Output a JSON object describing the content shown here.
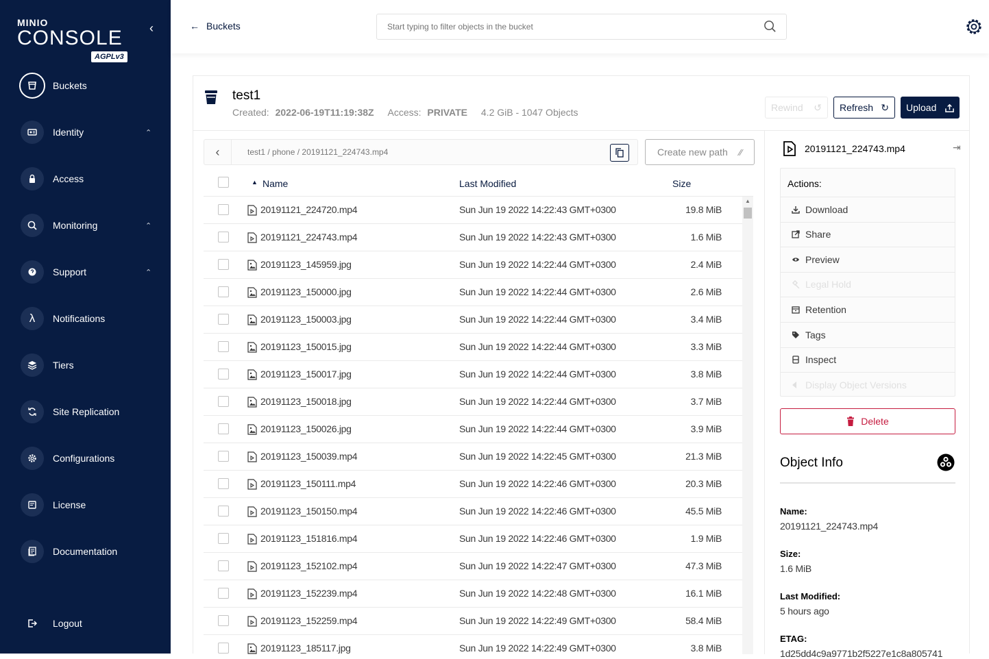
{
  "app": {
    "logo_top": "MINIO",
    "logo_main": "CONSOLE",
    "logo_badge": "AGPLv3"
  },
  "sidebar": {
    "items": [
      {
        "label": "Buckets",
        "icon": "bucket-icon"
      },
      {
        "label": "Identity",
        "icon": "identity-icon"
      },
      {
        "label": "Access",
        "icon": "lock-icon"
      },
      {
        "label": "Monitoring",
        "icon": "monitoring-icon"
      },
      {
        "label": "Support",
        "icon": "support-icon"
      },
      {
        "label": "Notifications",
        "icon": "lambda-icon"
      },
      {
        "label": "Tiers",
        "icon": "tiers-icon"
      },
      {
        "label": "Site Replication",
        "icon": "replication-icon"
      },
      {
        "label": "Configurations",
        "icon": "gear-icon"
      },
      {
        "label": "License",
        "icon": "license-icon"
      },
      {
        "label": "Documentation",
        "icon": "documentation-icon"
      }
    ],
    "logout": "Logout"
  },
  "topbar": {
    "back_label": "Buckets",
    "search_placeholder": "Start typing to filter objects in the bucket"
  },
  "bucket": {
    "name": "test1",
    "created_label": "Created:",
    "created": "2022-06-19T11:19:38Z",
    "access_label": "Access:",
    "access": "PRIVATE",
    "usage": "4.2 GiB - 1047 Objects"
  },
  "buttons": {
    "rewind": "Rewind",
    "refresh": "Refresh",
    "upload": "Upload",
    "create_path": "Create new path"
  },
  "path": {
    "text": "test1 / phone / 20191121_224743.mp4"
  },
  "table": {
    "headers": {
      "name": "Name",
      "modified": "Last Modified",
      "size": "Size"
    },
    "rows": [
      {
        "name": "20191121_224720.mp4",
        "modified": "Sun Jun 19 2022 14:22:43 GMT+0300",
        "size": "19.8 MiB",
        "type": "video"
      },
      {
        "name": "20191121_224743.mp4",
        "modified": "Sun Jun 19 2022 14:22:43 GMT+0300",
        "size": "1.6 MiB",
        "type": "video"
      },
      {
        "name": "20191123_145959.jpg",
        "modified": "Sun Jun 19 2022 14:22:44 GMT+0300",
        "size": "2.4 MiB",
        "type": "image"
      },
      {
        "name": "20191123_150000.jpg",
        "modified": "Sun Jun 19 2022 14:22:44 GMT+0300",
        "size": "2.6 MiB",
        "type": "image"
      },
      {
        "name": "20191123_150003.jpg",
        "modified": "Sun Jun 19 2022 14:22:44 GMT+0300",
        "size": "3.4 MiB",
        "type": "image"
      },
      {
        "name": "20191123_150015.jpg",
        "modified": "Sun Jun 19 2022 14:22:44 GMT+0300",
        "size": "3.3 MiB",
        "type": "image"
      },
      {
        "name": "20191123_150017.jpg",
        "modified": "Sun Jun 19 2022 14:22:44 GMT+0300",
        "size": "3.8 MiB",
        "type": "image"
      },
      {
        "name": "20191123_150018.jpg",
        "modified": "Sun Jun 19 2022 14:22:44 GMT+0300",
        "size": "3.7 MiB",
        "type": "image"
      },
      {
        "name": "20191123_150026.jpg",
        "modified": "Sun Jun 19 2022 14:22:44 GMT+0300",
        "size": "3.9 MiB",
        "type": "image"
      },
      {
        "name": "20191123_150039.mp4",
        "modified": "Sun Jun 19 2022 14:22:45 GMT+0300",
        "size": "21.3 MiB",
        "type": "video"
      },
      {
        "name": "20191123_150111.mp4",
        "modified": "Sun Jun 19 2022 14:22:46 GMT+0300",
        "size": "20.3 MiB",
        "type": "video"
      },
      {
        "name": "20191123_150150.mp4",
        "modified": "Sun Jun 19 2022 14:22:46 GMT+0300",
        "size": "45.5 MiB",
        "type": "video"
      },
      {
        "name": "20191123_151816.mp4",
        "modified": "Sun Jun 19 2022 14:22:46 GMT+0300",
        "size": "1.9 MiB",
        "type": "video"
      },
      {
        "name": "20191123_152102.mp4",
        "modified": "Sun Jun 19 2022 14:22:47 GMT+0300",
        "size": "47.3 MiB",
        "type": "video"
      },
      {
        "name": "20191123_152239.mp4",
        "modified": "Sun Jun 19 2022 14:22:48 GMT+0300",
        "size": "16.1 MiB",
        "type": "video"
      },
      {
        "name": "20191123_152259.mp4",
        "modified": "Sun Jun 19 2022 14:22:49 GMT+0300",
        "size": "58.4 MiB",
        "type": "video"
      },
      {
        "name": "20191123_185117.jpg",
        "modified": "Sun Jun 19 2022 14:22:49 GMT+0300",
        "size": "3.8 MiB",
        "type": "image"
      }
    ]
  },
  "panel": {
    "file": "20191121_224743.mp4",
    "actions_title": "Actions:",
    "actions": [
      {
        "label": "Download",
        "enabled": true,
        "icon": "download-icon"
      },
      {
        "label": "Share",
        "enabled": true,
        "icon": "share-icon"
      },
      {
        "label": "Preview",
        "enabled": true,
        "icon": "eye-icon"
      },
      {
        "label": "Legal Hold",
        "enabled": false,
        "icon": "gavel-icon"
      },
      {
        "label": "Retention",
        "enabled": true,
        "icon": "retention-icon"
      },
      {
        "label": "Tags",
        "enabled": true,
        "icon": "tag-icon"
      },
      {
        "label": "Inspect",
        "enabled": true,
        "icon": "inspect-icon"
      },
      {
        "label": "Display Object Versions",
        "enabled": false,
        "icon": "versions-icon"
      }
    ],
    "delete": "Delete",
    "info_title": "Object Info",
    "info": [
      {
        "label": "Name:",
        "value": "20191121_224743.mp4"
      },
      {
        "label": "Size:",
        "value": "1.6 MiB"
      },
      {
        "label": "Last Modified:",
        "value": "5 hours ago"
      },
      {
        "label": "ETAG:",
        "value": "1d25dd4c9a9771b2f5227e1c8a805741"
      }
    ]
  },
  "colors": {
    "sidebar": "#081c42",
    "danger": "#c51b3f",
    "primary": "#081c42"
  }
}
